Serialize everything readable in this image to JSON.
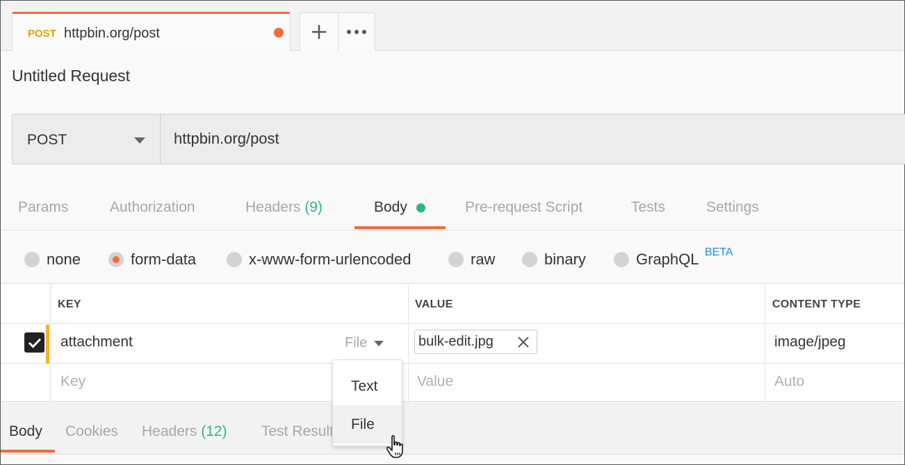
{
  "tab": {
    "method": "POST",
    "url": "httpbin.org/post"
  },
  "request": {
    "title": "Untitled Request",
    "method": "POST",
    "url": "httpbin.org/post"
  },
  "subtabs": {
    "params": "Params",
    "authorization": "Authorization",
    "headers": "Headers",
    "headers_count": "(9)",
    "body": "Body",
    "prerequest": "Pre-request Script",
    "tests": "Tests",
    "settings": "Settings"
  },
  "body_types": {
    "none": "none",
    "form_data": "form-data",
    "urlencoded": "x-www-form-urlencoded",
    "raw": "raw",
    "binary": "binary",
    "graphql": "GraphQL",
    "beta": "BETA",
    "selected": "form-data"
  },
  "table": {
    "headers": {
      "key": "KEY",
      "value": "VALUE",
      "content_type": "CONTENT TYPE"
    },
    "rows": [
      {
        "checked": true,
        "key": "attachment",
        "type": "File",
        "value": "bulk-edit.jpg",
        "content_type": "image/jpeg"
      }
    ],
    "empty_row": {
      "key_placeholder": "Key",
      "value_placeholder": "Value",
      "content_type_placeholder": "Auto"
    }
  },
  "type_menu": {
    "items": [
      "Text",
      "File"
    ],
    "hovered": "File"
  },
  "response_tabs": {
    "body": "Body",
    "cookies": "Cookies",
    "headers": "Headers",
    "headers_count": "(12)",
    "test_results": "Test Results"
  },
  "colors": {
    "accent": "#f26b3a",
    "success": "#2cb67d",
    "method": "#e2a100",
    "beta": "#1f8ce6"
  }
}
